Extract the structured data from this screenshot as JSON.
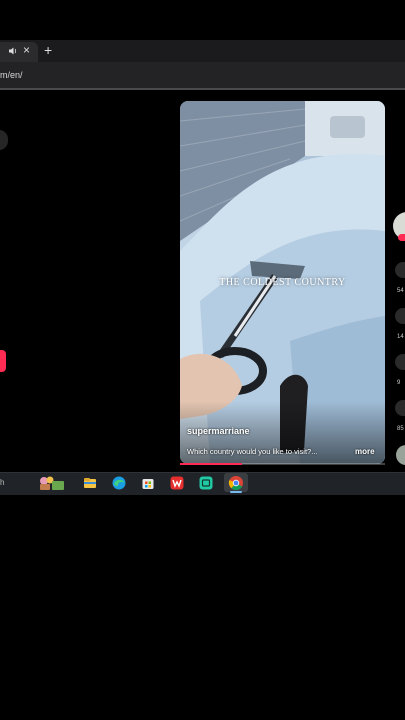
{
  "browser": {
    "tab_close_glyph": "×",
    "new_tab_glyph": "+",
    "url_fragment": "m/en/"
  },
  "video": {
    "overlay_text": "THE COLDEST COUNTRY",
    "username": "supermarriane",
    "caption": "Which country would you like to visit?...",
    "more_label": "more",
    "progress_fraction": 0.3
  },
  "rail": {
    "counts": [
      "54",
      "14",
      "9",
      "85"
    ]
  },
  "taskbar": {
    "search_fragment": "h",
    "apps": [
      "file-explorer",
      "edge",
      "store",
      "wps",
      "app-teal",
      "chrome"
    ]
  },
  "colors": {
    "accent": "#fe2c55",
    "taskbar": "#202327",
    "chrome_bg": "#1b1b1d"
  }
}
